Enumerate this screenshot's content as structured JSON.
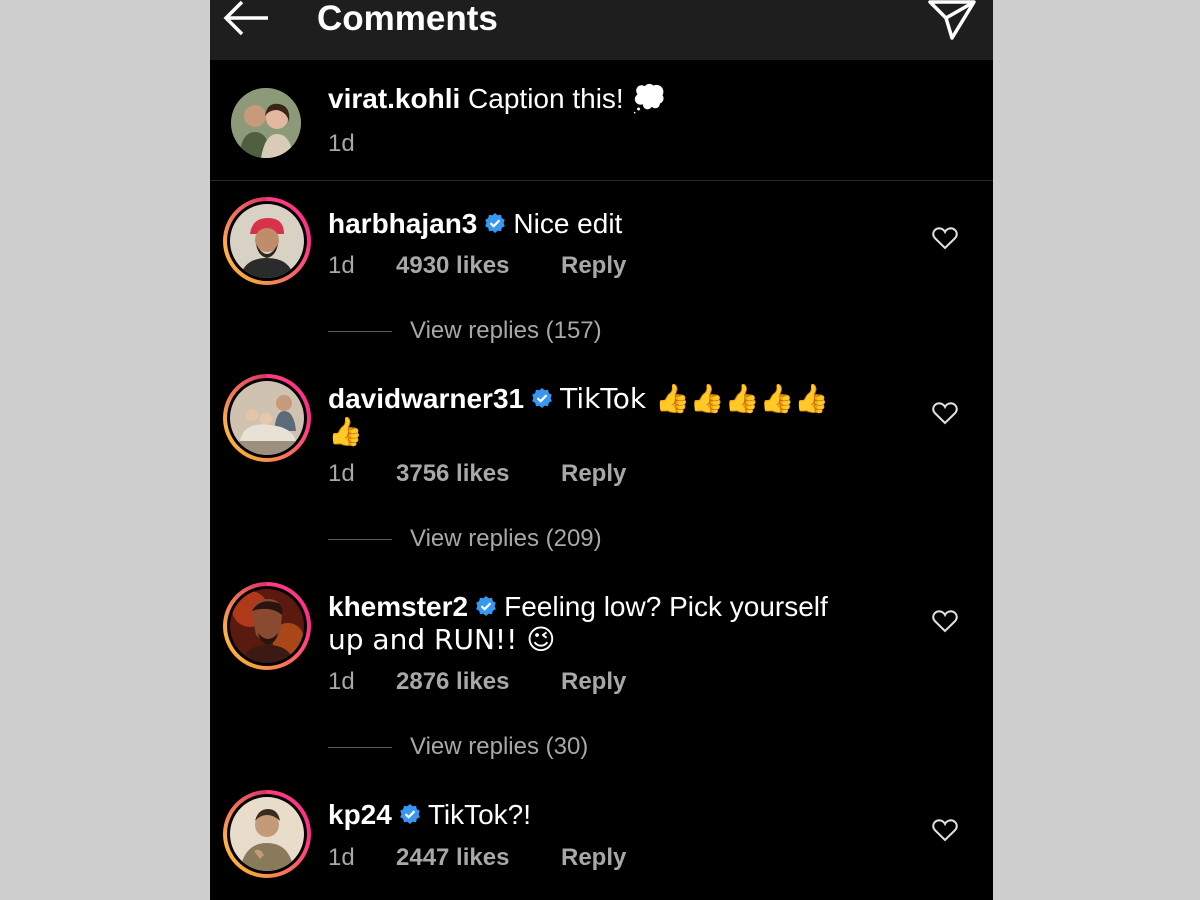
{
  "header": {
    "title": "Comments",
    "back_icon": "arrow-left-icon",
    "send_icon": "paper-plane-icon"
  },
  "caption": {
    "username": "virat.kohli",
    "text": "Caption this! 💭",
    "time": "1d"
  },
  "comments": [
    {
      "username": "harbhajan3",
      "verified": true,
      "text": "Nice edit",
      "text_line2": "",
      "time": "1d",
      "likes": "4930 likes",
      "reply_label": "Reply",
      "view_replies": "View replies (157)"
    },
    {
      "username": "davidwarner31",
      "verified": true,
      "text": "TikTok 👍👍👍👍👍",
      "text_line2": "👍",
      "time": "1d",
      "likes": "3756 likes",
      "reply_label": "Reply",
      "view_replies": "View replies (209)"
    },
    {
      "username": "khemster2",
      "verified": true,
      "text": "Feeling low? Pick yourself",
      "text_line2": "up and RUN!! 😉",
      "time": "1d",
      "likes": "2876 likes",
      "reply_label": "Reply",
      "view_replies": "View replies (30)"
    },
    {
      "username": "kp24",
      "verified": true,
      "text": "TikTok?!",
      "text_line2": "",
      "time": "1d",
      "likes": "2447 likes",
      "reply_label": "Reply",
      "view_replies": ""
    }
  ],
  "colors": {
    "background": "#000000",
    "header": "#1e1e1e",
    "muted_text": "#a8a8a8",
    "verified_blue": "#3897f0",
    "story_ring_start": "#e1306c",
    "story_ring_end": "#f4a43c"
  }
}
